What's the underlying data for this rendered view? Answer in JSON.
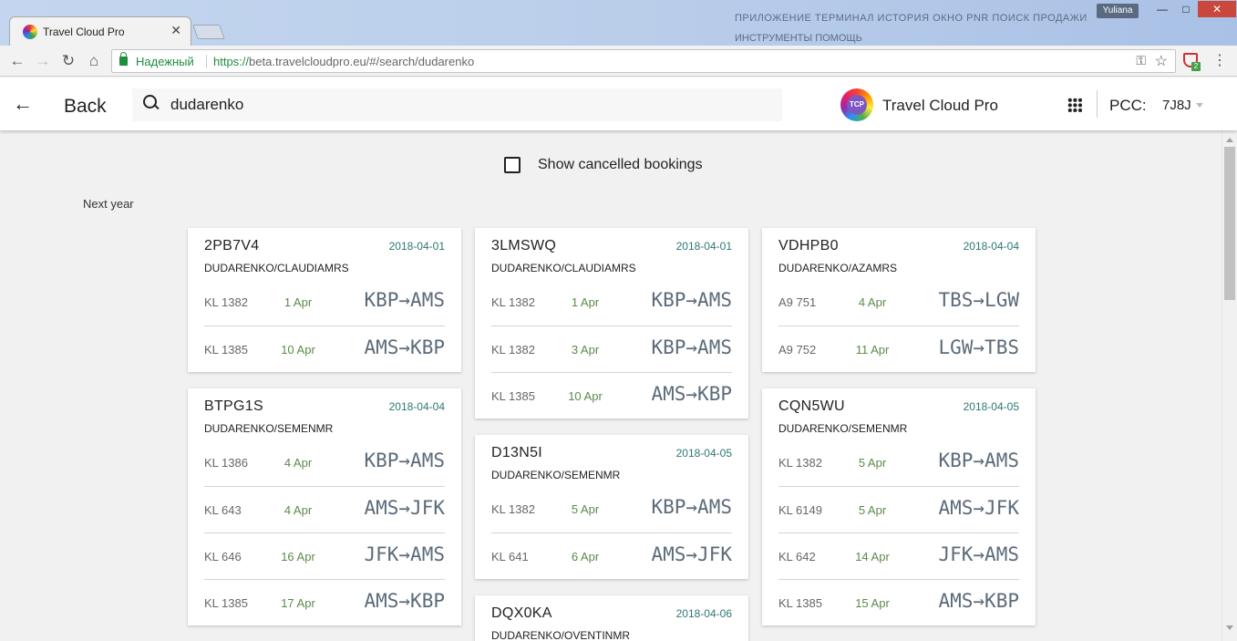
{
  "browser": {
    "tab_title": "Travel Cloud Pro",
    "tab_close": "✕",
    "window_user": "Yuliana",
    "secure_label": "Надежный",
    "url_scheme": "https://",
    "url_rest": "beta.travelcloudpro.eu/#/search/dudarenko",
    "extension_badge": "2",
    "bg_text_1": "ПРИЛОЖЕНИЕ ТЕРМИНАЛ ИСТОРИЯ ОКНО PNR ПОИСК ПРОДАЖИ",
    "bg_text_2": "ИНСТРУМЕНТЫ ПОМОЩЬ"
  },
  "header": {
    "back_label": "Back",
    "search_value": "dudarenko",
    "brand_logo_text": "TCP",
    "brand_name": "Travel Cloud Pro",
    "pcc_label": "PCC:",
    "pcc_value": "7J8J"
  },
  "filters": {
    "show_cancelled_label": "Show cancelled bookings",
    "show_cancelled_checked": false
  },
  "section_label": "Next year",
  "colors": {
    "date_accent": "#2c7873",
    "segment_date": "#5a8a4a",
    "route_text": "#5c6b7a",
    "secure_green": "#1e8e3e"
  },
  "bookings": [
    {
      "pnr": "2PB7V4",
      "date": "2018-04-01",
      "passenger": "DUDARENKO/CLAUDIAMRS",
      "segments": [
        {
          "flight": "KL 1382",
          "date": "1 Apr",
          "route": "KBP→AMS"
        },
        {
          "flight": "KL 1385",
          "date": "10 Apr",
          "route": "AMS→KBP"
        }
      ]
    },
    {
      "pnr": "BTPG1S",
      "date": "2018-04-04",
      "passenger": "DUDARENKO/SEMENMR",
      "segments": [
        {
          "flight": "KL 1386",
          "date": "4 Apr",
          "route": "KBP→AMS"
        },
        {
          "flight": "KL 643",
          "date": "4 Apr",
          "route": "AMS→JFK"
        },
        {
          "flight": "KL 646",
          "date": "16 Apr",
          "route": "JFK→AMS"
        },
        {
          "flight": "KL 1385",
          "date": "17 Apr",
          "route": "AMS→KBP"
        }
      ]
    },
    {
      "pnr": "3LMSWQ",
      "date": "2018-04-01",
      "passenger": "DUDARENKO/CLAUDIAMRS",
      "segments": [
        {
          "flight": "KL 1382",
          "date": "1 Apr",
          "route": "KBP→AMS"
        },
        {
          "flight": "KL 1382",
          "date": "3 Apr",
          "route": "KBP→AMS"
        },
        {
          "flight": "KL 1385",
          "date": "10 Apr",
          "route": "AMS→KBP"
        }
      ]
    },
    {
      "pnr": "D13N5I",
      "date": "2018-04-05",
      "passenger": "DUDARENKO/SEMENMR",
      "segments": [
        {
          "flight": "KL 1382",
          "date": "5 Apr",
          "route": "KBP→AMS"
        },
        {
          "flight": "KL 641",
          "date": "6 Apr",
          "route": "AMS→JFK"
        }
      ]
    },
    {
      "pnr": "DQX0KA",
      "date": "2018-04-06",
      "passenger": "DUDARENKO/OVENTINMR",
      "segments": []
    },
    {
      "pnr": "VDHPB0",
      "date": "2018-04-04",
      "passenger": "DUDARENKO/AZAMRS",
      "segments": [
        {
          "flight": "A9 751",
          "date": "4 Apr",
          "route": "TBS→LGW"
        },
        {
          "flight": "A9 752",
          "date": "11 Apr",
          "route": "LGW→TBS"
        }
      ]
    },
    {
      "pnr": "CQN5WU",
      "date": "2018-04-05",
      "passenger": "DUDARENKO/SEMENMR",
      "segments": [
        {
          "flight": "KL 1382",
          "date": "5 Apr",
          "route": "KBP→AMS"
        },
        {
          "flight": "KL 6149",
          "date": "5 Apr",
          "route": "AMS→JFK"
        },
        {
          "flight": "KL 642",
          "date": "14 Apr",
          "route": "JFK→AMS"
        },
        {
          "flight": "KL 1385",
          "date": "15 Apr",
          "route": "AMS→KBP"
        }
      ]
    }
  ]
}
